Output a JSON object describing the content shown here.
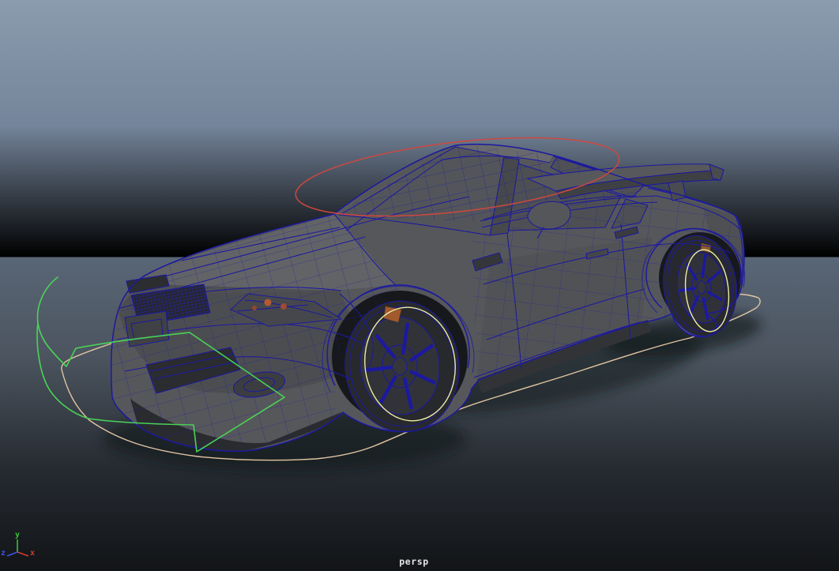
{
  "viewport": {
    "camera_label": "persp",
    "background_gradient_top": "#8a9cae",
    "background_gradient_mid": "#4c5560",
    "background_gradient_bottom": "#121417"
  },
  "axis_gizmo": {
    "x": {
      "label": "x",
      "color": "#d23b2e"
    },
    "y": {
      "label": "y",
      "color": "#37c437"
    },
    "z": {
      "label": "z",
      "color": "#3c55e6"
    }
  },
  "scene": {
    "model": {
      "body_color": "#56575b",
      "wireframe_color": "#1c19a0",
      "glass_color": "#53555a",
      "tire_color": "#28292d",
      "brake_caliper_color": "#a2592c",
      "headlamp_bulb_color": "#b35a35"
    },
    "curves": {
      "roof_ellipse": {
        "color": "#d0473f"
      },
      "front_arrow": {
        "color": "#49d355"
      },
      "front_wheel_circle": {
        "color": "#eceda4"
      },
      "rear_wheel_circle": {
        "color": "#eceda4"
      },
      "ground_ellipse": {
        "color": "#e2c5a4"
      }
    }
  }
}
